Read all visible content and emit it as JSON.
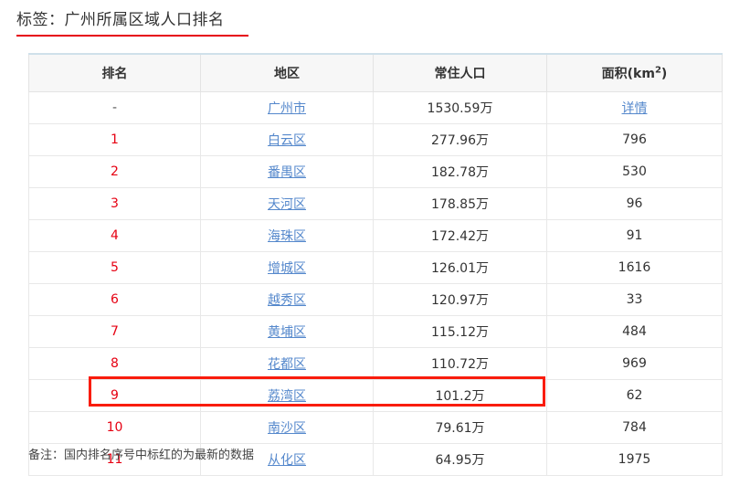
{
  "page": {
    "title": "标签：广州所属区域人口排名",
    "footer_note": "备注：国内排名序号中标红的为最新的数据"
  },
  "colors": {
    "title_underline": "#e60012",
    "rank_red": "#e60012",
    "link_blue": "#5588cc",
    "highlight_red": "#f91c0c",
    "header_bg": "#f7f7f7",
    "border": "#e8e8e8",
    "table_top_border": "#cfe0ea"
  },
  "table": {
    "headers": [
      {
        "label": "排名"
      },
      {
        "label": "地区"
      },
      {
        "label": "常住人口"
      },
      {
        "label_main": "面积(km",
        "label_sup": "2",
        "label_tail": ")"
      }
    ],
    "rows": [
      {
        "rank": "-",
        "rank_style": "dash",
        "area": "广州市",
        "area_link": true,
        "population": "1530.59万",
        "size": "详情",
        "size_link": true
      },
      {
        "rank": "1",
        "rank_style": "red",
        "area": "白云区",
        "area_link": true,
        "population": "277.96万",
        "size": "796",
        "size_link": false
      },
      {
        "rank": "2",
        "rank_style": "red",
        "area": "番禺区",
        "area_link": true,
        "population": "182.78万",
        "size": "530",
        "size_link": false
      },
      {
        "rank": "3",
        "rank_style": "red",
        "area": "天河区",
        "area_link": true,
        "population": "178.85万",
        "size": "96",
        "size_link": false
      },
      {
        "rank": "4",
        "rank_style": "red",
        "area": "海珠区",
        "area_link": true,
        "population": "172.42万",
        "size": "91",
        "size_link": false
      },
      {
        "rank": "5",
        "rank_style": "red",
        "area": "增城区",
        "area_link": true,
        "population": "126.01万",
        "size": "1616",
        "size_link": false
      },
      {
        "rank": "6",
        "rank_style": "red",
        "area": "越秀区",
        "area_link": true,
        "population": "120.97万",
        "size": "33",
        "size_link": false
      },
      {
        "rank": "7",
        "rank_style": "red",
        "area": "黄埔区",
        "area_link": true,
        "population": "115.12万",
        "size": "484",
        "size_link": false
      },
      {
        "rank": "8",
        "rank_style": "red",
        "area": "花都区",
        "area_link": true,
        "population": "110.72万",
        "size": "969",
        "size_link": false
      },
      {
        "rank": "9",
        "rank_style": "red",
        "area": "荔湾区",
        "area_link": true,
        "population": "101.2万",
        "size": "62",
        "size_link": false
      },
      {
        "rank": "10",
        "rank_style": "red",
        "area": "南沙区",
        "area_link": true,
        "population": "79.61万",
        "size": "784",
        "size_link": false,
        "highlighted": true
      },
      {
        "rank": "11",
        "rank_style": "red",
        "area": "从化区",
        "area_link": true,
        "population": "64.95万",
        "size": "1975",
        "size_link": false
      }
    ]
  }
}
